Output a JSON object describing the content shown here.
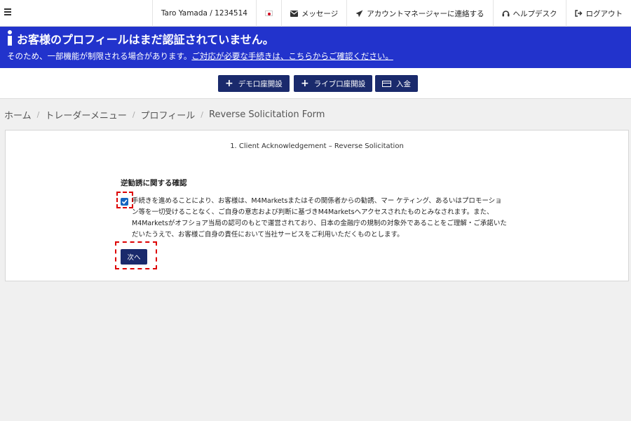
{
  "topbar": {
    "user": "Taro Yamada / 1234514",
    "messages": "メッセージ",
    "contact_manager": "アカウントマネージャーに連絡する",
    "helpdesk": "ヘルプデスク",
    "logout": "ログアウト"
  },
  "alert": {
    "title": "お客様のプロフィールはまだ認証されていません。",
    "text": "そのため、一部機能が制限される場合があります。",
    "link": "ご対応が必要な手続きは、こちらからご確認ください。",
    "color": "#2233cc"
  },
  "actions": {
    "demo": "デモ口座開設",
    "live": "ライブ口座開設",
    "deposit": "入金",
    "color": "#1a2a6c"
  },
  "breadcrumb": [
    "ホーム",
    "トレーダーメニュー",
    "プロフィール",
    "Reverse Solicitation Form"
  ],
  "form": {
    "step_title": "1. Client Acknowledgement – Reverse Solicitation",
    "section_title": "逆勧誘に関する確認",
    "consent_text": "手続きを進めることにより、お客様は、M4Marketsまたはその関係者からの勧誘、マー ケティング、あるいはプロモーション等を一切受けることなく、ご自身の意志および判断に基づきM4Marketsへアクセスされたものとみなされます。また、M4Marketsがオフショア当局の認可のもとで運営されており、日本の金融庁の規制の対象外であることをご理解・ご承諾いただいたうえで、お客様ご自身の責任において当社サービスをご利用いただくものとします。",
    "checkbox_checked": true,
    "next_label": "次へ"
  }
}
